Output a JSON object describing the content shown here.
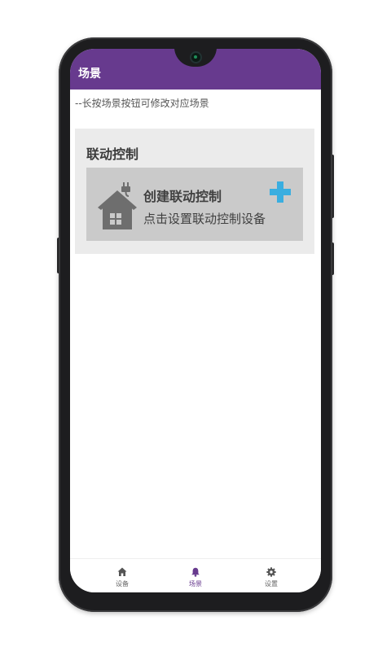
{
  "app": {
    "title": "场景"
  },
  "hint": "--长按场景按钮可修改对应场景",
  "section": {
    "title": "联动控制",
    "card": {
      "title": "创建联动控制",
      "subtitle": "点击设置联动控制设备",
      "icon": "smart-home-icon",
      "action_icon": "plus-icon"
    }
  },
  "bottom_nav": {
    "items": [
      {
        "label": "设备",
        "icon": "home-icon",
        "active": false
      },
      {
        "label": "场景",
        "icon": "bell-icon",
        "active": true
      },
      {
        "label": "设置",
        "icon": "gear-icon",
        "active": false
      }
    ]
  },
  "colors": {
    "accent": "#673a8e",
    "plus": "#3aaee0",
    "card_bg": "#cacaca",
    "section_bg": "#ebebeb",
    "house": "#6e6e6e"
  }
}
